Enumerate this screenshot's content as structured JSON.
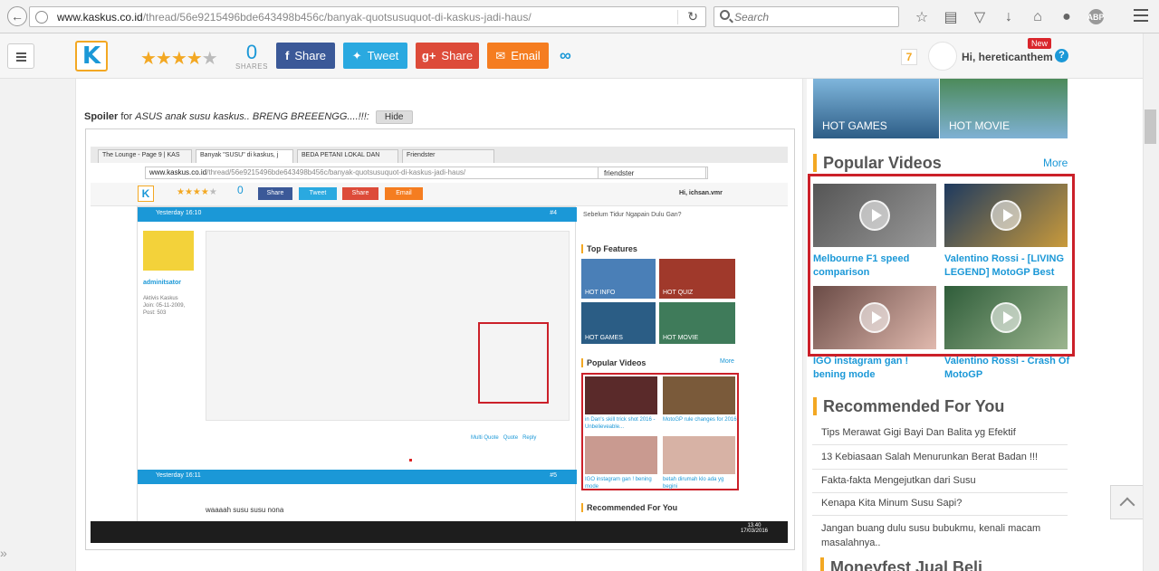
{
  "browser": {
    "url_domain": "www.kaskus.co.id",
    "url_path": "/thread/56e9215496bde643498b456c/banyak-quotsusuquot-di-kaskus-jadi-haus/",
    "search_placeholder": "Search"
  },
  "header": {
    "share_count": "0",
    "shares_label": "SHARES",
    "buttons": {
      "facebook": "Share",
      "twitter": "Tweet",
      "gplus": "Share",
      "email": "Email"
    },
    "notification_count": "7",
    "username": "Hi, hereticanthem",
    "new_badge": "New",
    "help": "?"
  },
  "post": {
    "spoiler_label": "Spoiler",
    "spoiler_for": "for",
    "spoiler_title": "ASUS anak susu kaskus.. BRENG BREEENGG....!!!:",
    "hide_label": "Hide"
  },
  "inner": {
    "tabs": [
      "The Lounge - Page 9 | KAS",
      "Banyak \"SUSU\" di kaskus, j",
      "BEDA PETANI LOKAL DAN",
      "Friendster"
    ],
    "url_domain": "www.kaskus.co.id",
    "url_path": "/thread/56e9215496bde643498b456c/banyak-quotsusuquot-di-kaskus-jadi-haus/",
    "search_text": "friendster",
    "share_count": "0",
    "btn_share": "Share",
    "btn_tweet": "Tweet",
    "btn_share2": "Share",
    "btn_email": "Email",
    "username": "Hi, ichsan.vmr",
    "post1_time": "Yesterday 16:10",
    "post1_num": "#4",
    "post2_time": "Yesterday 16:11",
    "post2_num": "#5",
    "poster": "adminitsator",
    "poster_meta1": "Aktivis Kaskus",
    "poster_meta2": "Join: 05-11-2009,",
    "poster_meta3": "Post: 503",
    "quote_labels": [
      "Multi Quote",
      "Quote",
      "Reply"
    ],
    "post2_text": "waaaah susu susu nona",
    "sidebar_text": "Sebelum Tidur Ngapain Dulu Gan?",
    "top_features": "Top Features",
    "hot_labels": [
      "HOT INFO",
      "HOT QUIZ",
      "HOT GAMES",
      "HOT MOVIE"
    ],
    "popular_videos": "Popular Videos",
    "more": "More",
    "vid_captions": [
      "in Dan's skill trick shot 2016 - Unbelieveable...",
      "MotoGP rule changes for 2016",
      "IGO instagram gan ! bening mode",
      "betah dirumah klo ada yg begini"
    ],
    "recommended": "Recommended For You",
    "clock_time": "13.40",
    "clock_date": "17/03/2016"
  },
  "sidebar": {
    "hot": [
      {
        "label": "HOT GAMES"
      },
      {
        "label": "HOT MOVIE"
      }
    ],
    "popular_videos_title": "Popular Videos",
    "more_label": "More",
    "videos": [
      {
        "caption": "Melbourne F1 speed comparison"
      },
      {
        "caption": "Valentino Rossi - [LIVING LEGEND] MotoGP Best"
      },
      {
        "caption": "IGO instagram gan ! bening mode"
      },
      {
        "caption": "Valentino Rossi - Crash Of MotoGP"
      }
    ],
    "recommended_title": "Recommended For You",
    "recommended": [
      "Tips Merawat Gigi Bayi Dan Balita yg Efektif",
      "13 Kebiasaan Salah Menurunkan Berat Badan !!!",
      "Fakta-fakta Mengejutkan dari Susu",
      "Kenapa Kita Minum Susu Sapi?",
      "Jangan buang dulu susu bubukmu, kenali macam masalahnya.."
    ],
    "next_title": "Moneyfest Jual Beli"
  },
  "colors": {
    "brand_blue": "#1b98d7",
    "brand_orange": "#f3a823",
    "highlight_red": "#cb2029"
  }
}
